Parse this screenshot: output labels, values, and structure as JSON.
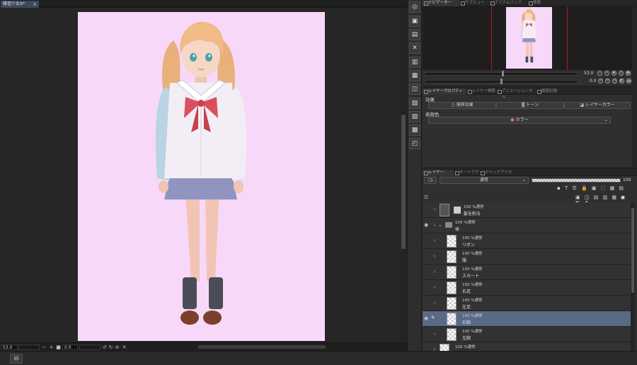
{
  "document_tab": {
    "title": "練習少女A*",
    "close": "×"
  },
  "status": {
    "zoom": "53.0",
    "rotation": "0.0",
    "minus": "−",
    "plus": "+"
  },
  "bottom": {
    "button_icon": "panel-toggle-icon",
    "button_glyph": "⊟"
  },
  "tools": [
    {
      "icon": "navigator-icon",
      "glyph": "◎"
    },
    {
      "icon": "new-layer-icon",
      "glyph": "▣"
    },
    {
      "icon": "copy-icon",
      "glyph": "▤"
    },
    {
      "icon": "delete-icon",
      "glyph": "✕"
    },
    {
      "icon": "paste-icon",
      "glyph": "▥"
    },
    {
      "icon": "clip-icon",
      "glyph": "▦"
    },
    {
      "icon": "transform-icon",
      "glyph": "◫"
    },
    {
      "icon": "frame-icon",
      "glyph": "▧"
    },
    {
      "icon": "select-icon",
      "glyph": "▨"
    },
    {
      "icon": "image-icon",
      "glyph": "▩"
    },
    {
      "icon": "layer-move-icon",
      "glyph": "◰"
    }
  ],
  "navigator": {
    "tabs": [
      "ナビゲーター",
      "サブビュー",
      "アイテムバンク",
      "情報"
    ],
    "zoom_value": "53.0",
    "rotation_value": "0.0"
  },
  "layer_property": {
    "tabs": [
      "レイヤープロパティ",
      "レイヤー検索",
      "アニメーションセル",
      "履歴記録"
    ],
    "effect_label": "効果",
    "effect_buttons": [
      "境界効果",
      "トーン",
      "レイヤーカラー"
    ],
    "color_label": "表現色",
    "color_value": "カラー"
  },
  "layer_panel": {
    "tabs": [
      "レイヤー",
      "オートアクション",
      "クイックアクセス"
    ],
    "blend_mode": "通常",
    "opacity": "100",
    "rows": [
      {
        "mode": "100 %通常",
        "name": "髪を削る",
        "indent": 0,
        "eye": false,
        "kind": "mask"
      },
      {
        "mode": "100 %通常",
        "name": "体",
        "indent": 0,
        "eye": true,
        "kind": "folder"
      },
      {
        "mode": "100 %通常",
        "name": "リボン",
        "indent": 1,
        "eye": false,
        "kind": "raster"
      },
      {
        "mode": "100 %通常",
        "name": "服",
        "indent": 1,
        "eye": false,
        "kind": "raster"
      },
      {
        "mode": "100 %通常",
        "name": "スカート",
        "indent": 1,
        "eye": false,
        "kind": "raster"
      },
      {
        "mode": "100 %通常",
        "name": "右足",
        "indent": 1,
        "eye": false,
        "kind": "raster"
      },
      {
        "mode": "100 %通常",
        "name": "左足",
        "indent": 1,
        "eye": false,
        "kind": "raster"
      },
      {
        "mode": "100 %通常",
        "name": "右腕",
        "indent": 1,
        "eye": true,
        "kind": "raster",
        "selected": true
      },
      {
        "mode": "100 %通常",
        "name": "左腕",
        "indent": 1,
        "eye": false,
        "kind": "raster"
      },
      {
        "mode": "100 %通常",
        "name": "首",
        "indent": 0,
        "eye": false,
        "kind": "raster"
      },
      {
        "mode": "100 %通常",
        "name": "",
        "indent": 0,
        "eye": false,
        "kind": "raster"
      }
    ]
  },
  "colors": {
    "canvas_bg": "#f8d8f8",
    "selected_row": "#5a6a86",
    "nav_frame": "#b01818"
  }
}
